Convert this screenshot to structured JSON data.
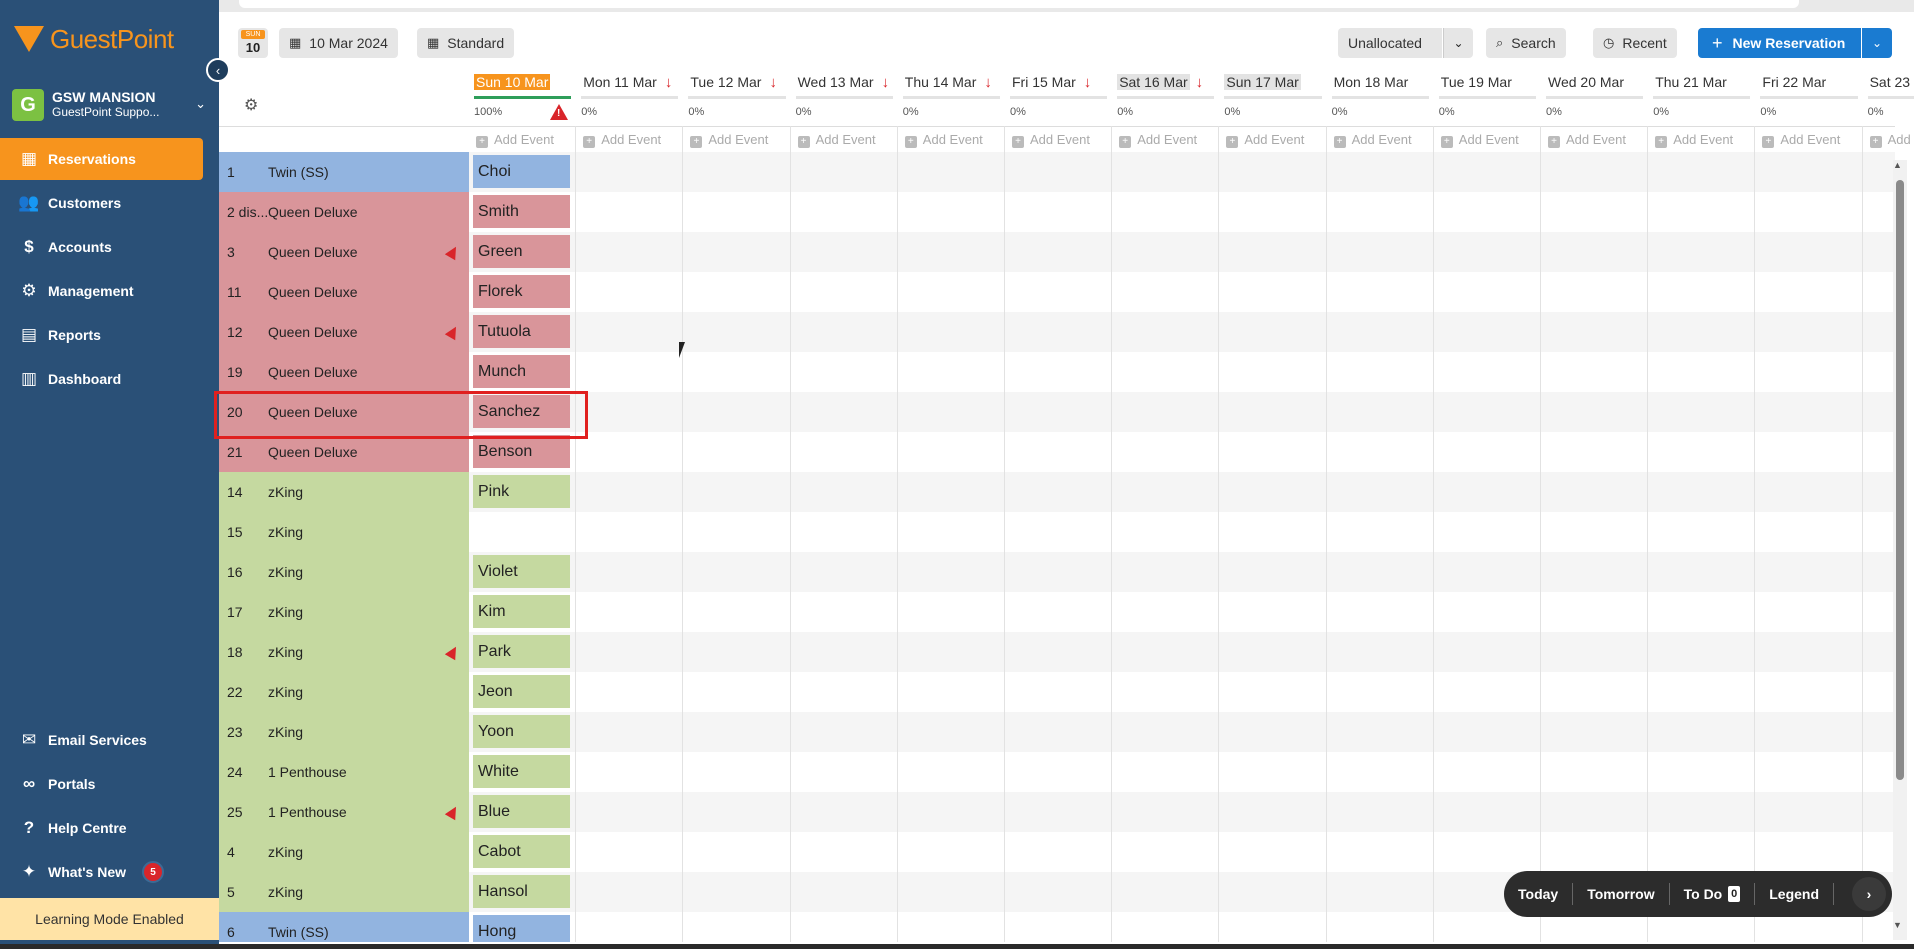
{
  "colors": {
    "sidebar_bg": "#2a5077",
    "accent": "#f7941d",
    "primary_button": "#1a7bd1",
    "twin_room": "#92b4e0",
    "queen_room": "#d9959a",
    "king_room": "#c5d9a0",
    "highlight_border": "#e0201f"
  },
  "sidebar": {
    "brand_name": "GuestPoint",
    "property_initial": "G",
    "property_name": "GSW MANSION",
    "property_sub": "GuestPoint Suppo...",
    "nav_top": [
      {
        "label": "Reservations",
        "icon": "calendar-icon",
        "active": true
      },
      {
        "label": "Customers",
        "icon": "people-icon",
        "active": false
      },
      {
        "label": "Accounts",
        "icon": "dollar-icon",
        "active": false
      },
      {
        "label": "Management",
        "icon": "user-gear-icon",
        "active": false
      },
      {
        "label": "Reports",
        "icon": "document-icon",
        "active": false
      },
      {
        "label": "Dashboard",
        "icon": "bar-chart-icon",
        "active": false
      }
    ],
    "nav_bottom": [
      {
        "label": "Email Services",
        "icon": "email-icon"
      },
      {
        "label": "Portals",
        "icon": "link-icon"
      },
      {
        "label": "Help Centre",
        "icon": "help-icon"
      },
      {
        "label": "What's New",
        "icon": "sparkle-icon",
        "badge": "5"
      }
    ],
    "learning_mode": "Learning Mode Enabled"
  },
  "toolbar": {
    "day_badge_dow": "SUN",
    "day_badge_num": "10",
    "date_label": "10 Mar 2024",
    "view_label": "Standard",
    "unallocated_label": "Unallocated",
    "search_label": "Search",
    "recent_label": "Recent",
    "new_reservation_label": "New Reservation"
  },
  "grid": {
    "add_event_label": "Add Event",
    "dates": [
      {
        "label": "Sun 10 Mar",
        "pct": "100%",
        "today": true,
        "weekend": false,
        "arrow": false,
        "warning": true
      },
      {
        "label": "Mon 11 Mar",
        "pct": "0%",
        "today": false,
        "weekend": false,
        "arrow": true
      },
      {
        "label": "Tue 12 Mar",
        "pct": "0%",
        "today": false,
        "weekend": false,
        "arrow": true
      },
      {
        "label": "Wed 13 Mar",
        "pct": "0%",
        "today": false,
        "weekend": false,
        "arrow": true
      },
      {
        "label": "Thu 14 Mar",
        "pct": "0%",
        "today": false,
        "weekend": false,
        "arrow": true
      },
      {
        "label": "Fri 15 Mar",
        "pct": "0%",
        "today": false,
        "weekend": false,
        "arrow": true
      },
      {
        "label": "Sat 16 Mar",
        "pct": "0%",
        "today": false,
        "weekend": true,
        "arrow": true
      },
      {
        "label": "Sun 17 Mar",
        "pct": "0%",
        "today": false,
        "weekend": true,
        "arrow": false
      },
      {
        "label": "Mon 18 Mar",
        "pct": "0%",
        "today": false,
        "weekend": false,
        "arrow": false
      },
      {
        "label": "Tue 19 Mar",
        "pct": "0%",
        "today": false,
        "weekend": false,
        "arrow": false
      },
      {
        "label": "Wed 20 Mar",
        "pct": "0%",
        "today": false,
        "weekend": false,
        "arrow": false
      },
      {
        "label": "Thu 21 Mar",
        "pct": "0%",
        "today": false,
        "weekend": false,
        "arrow": false
      },
      {
        "label": "Fri 22 Mar",
        "pct": "0%",
        "today": false,
        "weekend": false,
        "arrow": false
      },
      {
        "label": "Sat 23",
        "pct": "0%",
        "today": false,
        "weekend": false,
        "arrow": false
      }
    ],
    "rooms": [
      {
        "num": "1",
        "type": "Twin (SS)",
        "cat": "twin",
        "guest": "Choi",
        "broom": false
      },
      {
        "num": "2 dis...",
        "type": "Queen Deluxe",
        "cat": "queen",
        "guest": "Smith",
        "broom": false
      },
      {
        "num": "3",
        "type": "Queen Deluxe",
        "cat": "queen",
        "guest": "Green",
        "broom": true
      },
      {
        "num": "11",
        "type": "Queen Deluxe",
        "cat": "queen",
        "guest": "Florek",
        "broom": false
      },
      {
        "num": "12",
        "type": "Queen Deluxe",
        "cat": "queen",
        "guest": "Tutuola",
        "broom": true
      },
      {
        "num": "19",
        "type": "Queen Deluxe",
        "cat": "queen",
        "guest": "Munch",
        "broom": false
      },
      {
        "num": "20",
        "type": "Queen Deluxe",
        "cat": "queen",
        "guest": "Sanchez",
        "broom": false
      },
      {
        "num": "21",
        "type": "Queen Deluxe",
        "cat": "queen",
        "guest": "Benson",
        "broom": false
      },
      {
        "num": "14",
        "type": "zKing",
        "cat": "king",
        "guest": "Pink",
        "broom": false
      },
      {
        "num": "15",
        "type": "zKing",
        "cat": "king",
        "guest": "",
        "broom": false
      },
      {
        "num": "16",
        "type": "zKing",
        "cat": "king",
        "guest": "Violet",
        "broom": false
      },
      {
        "num": "17",
        "type": "zKing",
        "cat": "king",
        "guest": "Kim",
        "broom": false
      },
      {
        "num": "18",
        "type": "zKing",
        "cat": "king",
        "guest": "Park",
        "broom": true
      },
      {
        "num": "22",
        "type": "zKing",
        "cat": "king",
        "guest": "Jeon",
        "broom": false
      },
      {
        "num": "23",
        "type": "zKing",
        "cat": "king",
        "guest": "Yoon",
        "broom": false
      },
      {
        "num": "24",
        "type": "1 Penthouse",
        "cat": "king",
        "guest": "White",
        "broom": false
      },
      {
        "num": "25",
        "type": "1 Penthouse",
        "cat": "king",
        "guest": "Blue",
        "broom": true
      },
      {
        "num": "4",
        "type": "zKing",
        "cat": "king",
        "guest": "Cabot",
        "broom": false
      },
      {
        "num": "5",
        "type": "zKing",
        "cat": "king",
        "guest": "Hansol",
        "broom": false
      },
      {
        "num": "6",
        "type": "Twin (SS)",
        "cat": "twin",
        "guest": "Hong",
        "broom": false
      }
    ]
  },
  "bottom_bar": {
    "today": "Today",
    "tomorrow": "Tomorrow",
    "todo": "To Do",
    "todo_count": "0",
    "legend": "Legend"
  }
}
